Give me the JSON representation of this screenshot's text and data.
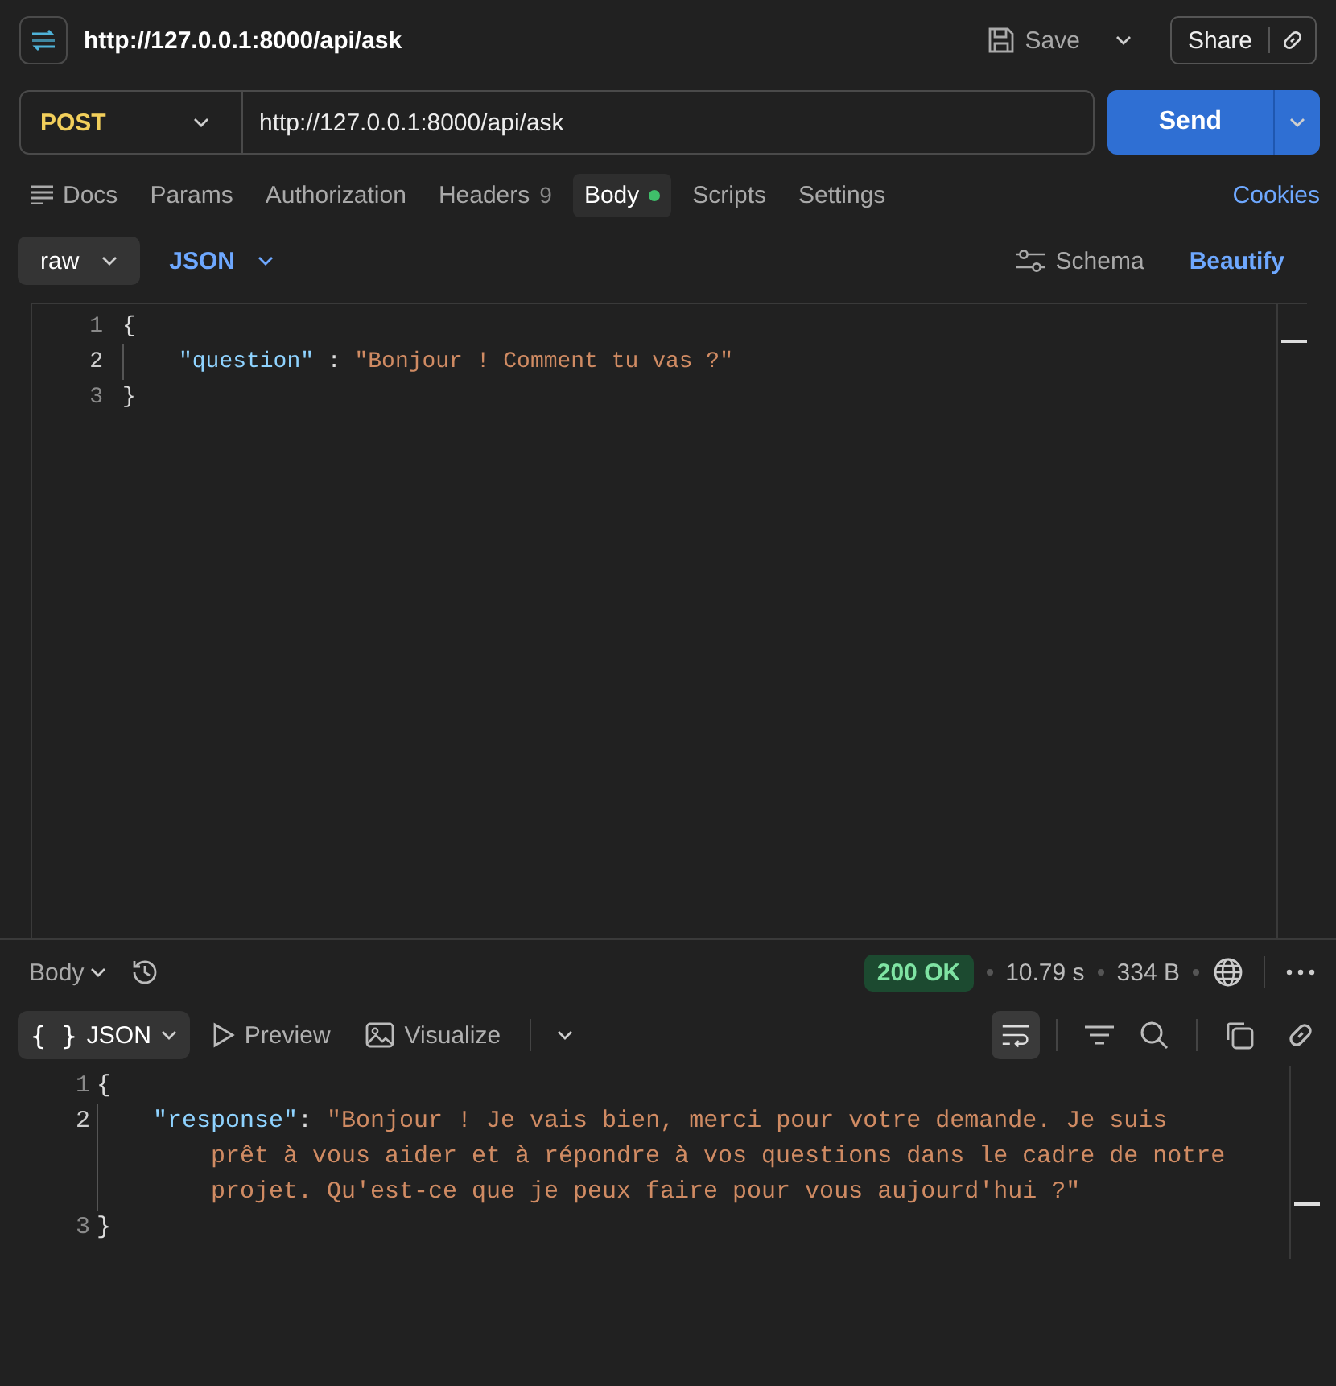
{
  "request": {
    "title": "http://127.0.0.1:8000/api/ask",
    "save_label": "Save",
    "share_label": "Share",
    "method": "POST",
    "url": "http://127.0.0.1:8000/api/ask",
    "send_label": "Send"
  },
  "tabs": [
    {
      "label": "Docs",
      "kind": "docs",
      "selected": false
    },
    {
      "label": "Params",
      "kind": "plain",
      "selected": false
    },
    {
      "label": "Authorization",
      "kind": "plain",
      "selected": false
    },
    {
      "label": "Headers",
      "kind": "count",
      "count": "9",
      "selected": false
    },
    {
      "label": "Body",
      "kind": "dot",
      "selected": true
    },
    {
      "label": "Scripts",
      "kind": "plain",
      "selected": false
    },
    {
      "label": "Settings",
      "kind": "plain",
      "selected": false
    }
  ],
  "cookies_label": "Cookies",
  "body_options": {
    "mode": "raw",
    "language": "JSON",
    "schema_label": "Schema",
    "beautify_label": "Beautify"
  },
  "request_body": [
    {
      "number": "1",
      "indented": false,
      "tokens": [
        {
          "kind": "punct",
          "text": "{"
        }
      ]
    },
    {
      "number": "2",
      "indented": true,
      "tokens": [
        {
          "kind": "key",
          "text": "\"question\""
        },
        {
          "kind": "punct",
          "text": " : "
        },
        {
          "kind": "string",
          "text": "\"Bonjour ! Comment tu vas ?\""
        }
      ]
    },
    {
      "number": "3",
      "indented": false,
      "tokens": [
        {
          "kind": "punct",
          "text": "}"
        }
      ]
    }
  ],
  "response": {
    "section_label": "Body",
    "status": "200 OK",
    "time": "10.79 s",
    "size": "334 B",
    "views": [
      {
        "label": "JSON",
        "kind": "format",
        "icon_text": "{ }",
        "selected": true
      },
      {
        "label": "Preview",
        "kind": "preview",
        "selected": false
      },
      {
        "label": "Visualize",
        "kind": "visualize",
        "selected": false
      }
    ],
    "wrap_on": true,
    "lines": [
      {
        "number": "1",
        "indented": false,
        "tokens": [
          {
            "kind": "punct",
            "text": "{"
          }
        ]
      },
      {
        "number": "2",
        "indented": true,
        "tokens": [
          {
            "kind": "key",
            "text": "\"response\""
          },
          {
            "kind": "punct",
            "text": ": "
          },
          {
            "kind": "string",
            "text": "\"Bonjour ! Je vais bien, merci pour votre demande. Je suis prêt à vous aider et à répondre à vos questions dans le cadre de notre projet. Qu'est-ce que je peux faire pour vous aujourd'hui ?\""
          }
        ]
      },
      {
        "number": "3",
        "indented": false,
        "tokens": [
          {
            "kind": "punct",
            "text": "}"
          }
        ]
      }
    ]
  }
}
